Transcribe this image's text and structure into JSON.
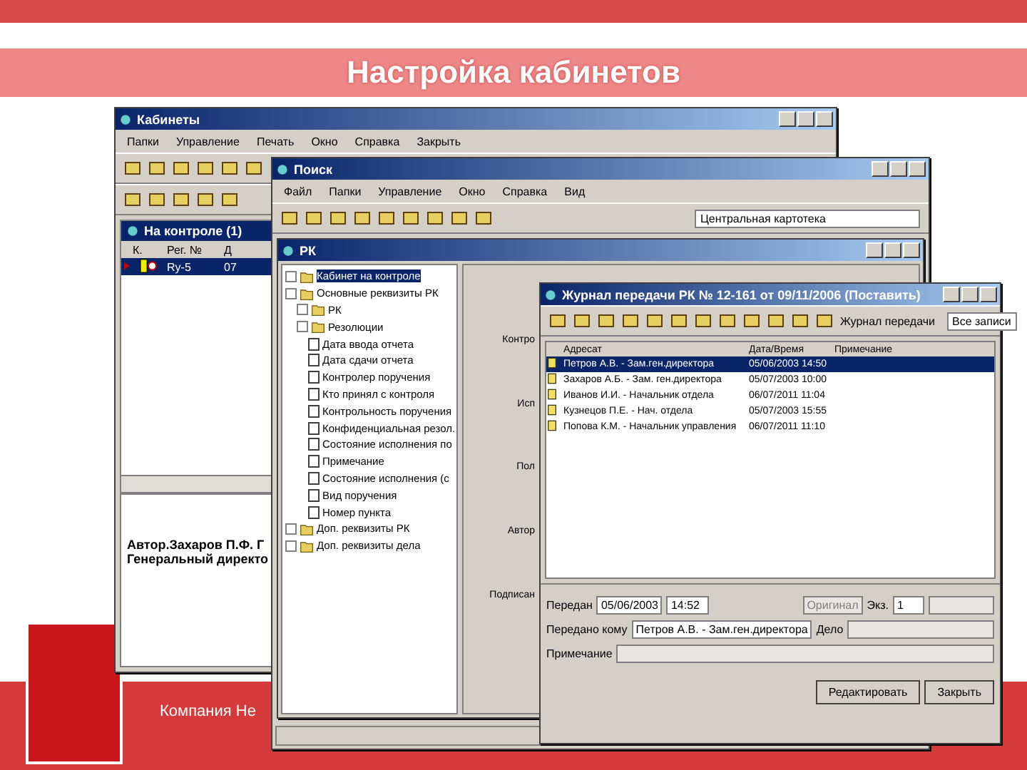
{
  "slide": {
    "title": "Настройка кабинетов",
    "footer": "Компания Не"
  },
  "cabinets_window": {
    "title": "Кабинеты",
    "menu": [
      "Папки",
      "Управление",
      "Печать",
      "Окно",
      "Справка",
      "Закрыть"
    ],
    "panel_title": "На контроле (1)",
    "columns": [
      "К.",
      "Рег. №",
      "Д"
    ],
    "rows": [
      {
        "cells": [
          "",
          "Ry-5",
          "07"
        ],
        "selected": true
      }
    ],
    "note_lines": [
      "Автор.Захаров П.Ф.   Г",
      "Генеральный директо"
    ]
  },
  "search_window": {
    "title": "Поиск",
    "menu": [
      "Файл",
      "Папки",
      "Управление",
      "Окно",
      "Справка",
      "Вид"
    ],
    "catalog": "Центральная картотека",
    "rk_window": {
      "title": "РК",
      "tree": [
        {
          "kind": "folder",
          "label": "Кабинет на контроле",
          "selected": true
        },
        {
          "kind": "folder",
          "label": "Основные реквизиты РК",
          "selected": false,
          "children": [
            {
              "kind": "folder",
              "label": "РК",
              "selected": false
            },
            {
              "kind": "folder",
              "label": "Резолюции",
              "selected": false,
              "children": [
                {
                  "kind": "check",
                  "label": "Дата ввода отчета",
                  "selected": false,
                  "checked": false
                },
                {
                  "kind": "check",
                  "label": "Дата сдачи отчета",
                  "selected": false,
                  "checked": false
                },
                {
                  "kind": "check",
                  "label": "Контролер поручения",
                  "selected": false,
                  "checked": false
                },
                {
                  "kind": "check",
                  "label": "Кто принял с контроля",
                  "selected": false,
                  "checked": false
                },
                {
                  "kind": "check",
                  "label": "Контрольность поручения",
                  "selected": false,
                  "checked": false
                },
                {
                  "kind": "check",
                  "label": "Конфиденциальная резол.",
                  "selected": false,
                  "checked": false
                },
                {
                  "kind": "check",
                  "label": "Состояние исполнения по",
                  "selected": false,
                  "checked": false
                },
                {
                  "kind": "check",
                  "label": "Примечание",
                  "selected": false,
                  "checked": false
                },
                {
                  "kind": "check",
                  "label": "Состояние исполнения (с",
                  "selected": false,
                  "checked": false
                },
                {
                  "kind": "check",
                  "label": "Вид поручения",
                  "selected": false,
                  "checked": false
                },
                {
                  "kind": "check",
                  "label": "Номер пункта",
                  "selected": false,
                  "checked": false
                }
              ]
            }
          ]
        },
        {
          "kind": "folder",
          "label": "Доп. реквизиты РК",
          "selected": false
        },
        {
          "kind": "folder",
          "label": "Доп. реквизиты дела",
          "selected": false
        }
      ],
      "field_labels": [
        "Контро",
        "Исп",
        "Пол",
        "Автор",
        "Подписан"
      ]
    }
  },
  "journal_window": {
    "title": "Журнал передачи РК № 12-161 от 09/11/2006 (Поставить)",
    "filter_label": "Журнал передачи",
    "filter_value": "Все записи",
    "columns": [
      "Адресат",
      "Дата/Время",
      "Примечание"
    ],
    "rows": [
      {
        "addressee": "Петров А.В. - Зам.ген.директора",
        "datetime": "05/06/2003 14:50",
        "selected": true
      },
      {
        "addressee": "Захаров А.Б. - Зам. ген.директора",
        "datetime": "05/07/2003 10:00",
        "selected": false
      },
      {
        "addressee": "Иванов И.И. - Начальник отдела",
        "datetime": "06/07/2011 11:04",
        "selected": false
      },
      {
        "addressee": "Кузнецов П.Е. - Нач. отдела",
        "datetime": "05/07/2003 15:55",
        "selected": false
      },
      {
        "addressee": "Попова К.М. - Начальник управления",
        "datetime": "06/07/2011 11:10",
        "selected": false
      }
    ],
    "sent_label": "Передан",
    "sent_date": "05/06/2003",
    "sent_time": "14:52",
    "original": "Оригинал",
    "copies_label": "Экз.",
    "copies": "1",
    "to_label": "Передано кому",
    "to_value": "Петров А.В. - Зам.ген.директора",
    "case_label": "Дело",
    "note_label": "Примечание",
    "buttons": [
      "Редактировать",
      "Закрыть"
    ]
  }
}
